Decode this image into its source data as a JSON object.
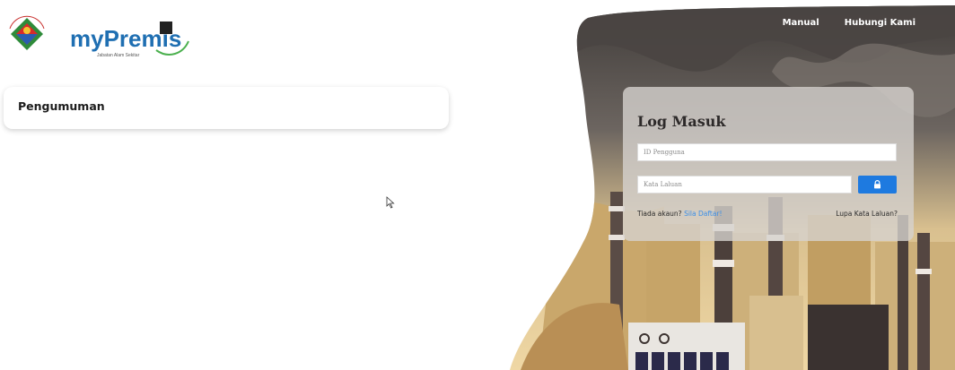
{
  "logo": {
    "brand_text": "myPremis",
    "tagline": "Jabatan Alam Sekitar",
    "emblem_text": "JABATAN ALAM SEKITAR"
  },
  "nav": {
    "manual": "Manual",
    "contact": "Hubungi Kami"
  },
  "announcement": {
    "title": "Pengumuman"
  },
  "login": {
    "title": "Log Masuk",
    "user_placeholder": "ID Pengguna",
    "password_placeholder": "Kata Laluan",
    "no_account": "Tiada akaun?",
    "signup": "Sila Daftar!",
    "forgot": "Lupa Kata Laluan?"
  },
  "colors": {
    "accent": "#1e7ae0",
    "link": "#3b8fe8",
    "smoke": "#6d6863",
    "sky": "#e8cf9c"
  },
  "icons": {
    "login_button": "lock-icon",
    "cursor": "mouse-cursor-icon"
  }
}
